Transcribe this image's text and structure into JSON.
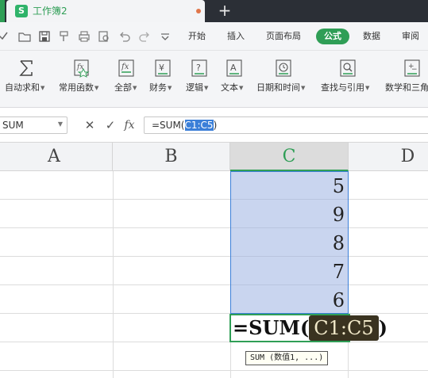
{
  "window": {
    "doc_tab_title": "工作簿2",
    "doc_icon_letter": "S",
    "new_tab_label": "+"
  },
  "menu": {
    "items": [
      "开始",
      "插入",
      "页面布局",
      "公式",
      "数据",
      "审阅"
    ],
    "active_index": 3
  },
  "quick_access_icons": [
    "open-folder-icon",
    "save-icon",
    "format-painter-icon",
    "print-icon",
    "print-preview-icon",
    "undo-icon",
    "redo-icon",
    "more-dropdown-icon"
  ],
  "ribbon": {
    "buttons": [
      {
        "label": "自动求和",
        "icon": "sigma-icon"
      },
      {
        "label": "常用函数",
        "icon": "fx-star-icon"
      },
      {
        "label": "全部",
        "icon": "fx-icon"
      },
      {
        "label": "财务",
        "icon": "yen-icon"
      },
      {
        "label": "逻辑",
        "icon": "question-icon"
      },
      {
        "label": "文本",
        "icon": "text-a-icon"
      },
      {
        "label": "日期和时间",
        "icon": "clock-icon"
      },
      {
        "label": "查找与引用",
        "icon": "magnifier-icon"
      },
      {
        "label": "数学和三角",
        "icon": "math-icon"
      }
    ]
  },
  "formula_bar": {
    "name_box": "SUM",
    "cancel_glyph": "✕",
    "enter_glyph": "✓",
    "fx_glyph": "fx",
    "formula_prefix": "=SUM(",
    "formula_ref": "C1:C5",
    "formula_suffix": ")"
  },
  "grid": {
    "columns": [
      "A",
      "B",
      "C",
      "D"
    ],
    "selected_column": "C",
    "column_c_values": [
      "5",
      "9",
      "8",
      "7",
      "6"
    ],
    "edit_prefix": "=SUM(",
    "edit_ref": "C1:C5",
    "edit_suffix": ")",
    "tooltip": "SUM (数值1, ...)"
  },
  "colors": {
    "accent_green": "#2f9e56",
    "selection_fill": "#c9d5ef",
    "reference_highlight": "#3b7fd8"
  }
}
